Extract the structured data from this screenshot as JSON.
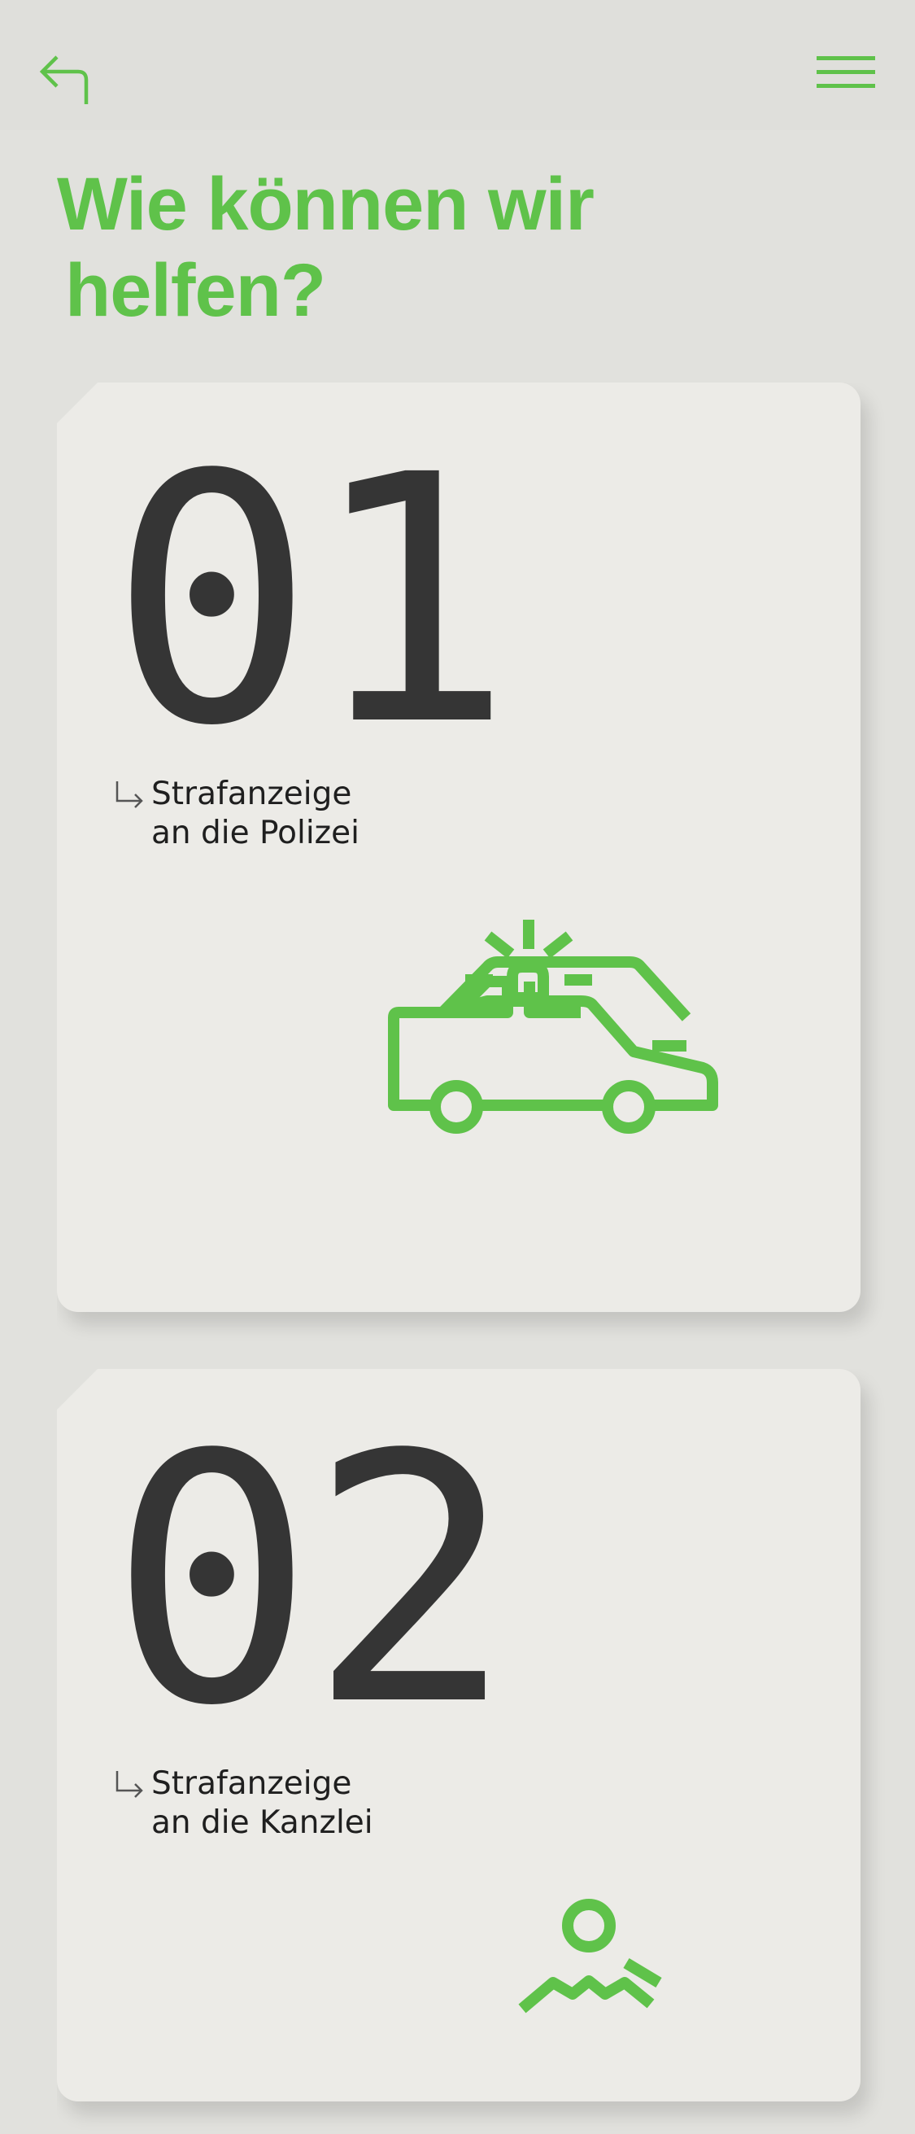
{
  "colors": {
    "accent": "#5fc24a",
    "background": "#e1e1dd",
    "card": "#ecebe7",
    "number": "#353535"
  },
  "header": {
    "back_icon": "return-arrow-icon",
    "menu_icon": "hamburger-menu-icon"
  },
  "title": {
    "line1": "Wie können wir",
    "line2": "helfen?"
  },
  "cards": [
    {
      "number": "01",
      "label_line1": "Strafanzeige",
      "label_line2": "an die Polizei",
      "arrow_icon": "down-right-arrow-icon",
      "illustration": "police-car-icon"
    },
    {
      "number": "02",
      "label_line1": "Strafanzeige",
      "label_line2": "an die Kanzlei",
      "arrow_icon": "down-right-arrow-icon",
      "illustration": "lawyer-person-icon"
    }
  ]
}
